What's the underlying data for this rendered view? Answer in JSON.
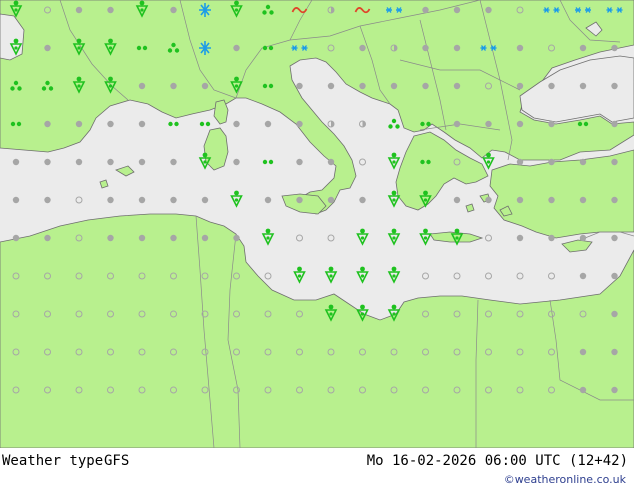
{
  "footer": {
    "product": "Weather type",
    "model": "GFS",
    "valid_time": "Mo 16-02-2026 06:00 UTC (12+42)",
    "credit": "©weatheronline.co.uk"
  },
  "colors": {
    "land": "#b8f08e",
    "sea": "#ebebeb",
    "border": "#8a8a8a",
    "coast": "#6e6e6e",
    "dry_dot": "#a6a6a6",
    "rain": "#1fc21f",
    "snow": "#1c9ce8",
    "thunder": "#e0442a"
  },
  "legend_icons": [
    "dry-dot-icon",
    "dry-ring-icon",
    "half-dot-icon",
    "light-rain-icon",
    "rain-icon",
    "rain-shower-icon",
    "snow-icon",
    "snow-shower-icon",
    "thunderstorm-icon"
  ],
  "map": {
    "region": "Mediterranean",
    "grid": {
      "cols": 21,
      "rows": 11,
      "cells": [
        "dsddhddrsrhtddddndddn",
        "rddrdhsddrndhddndndd",
        "hhrhdddrdddddddrdddd",
        "ddddddddddhhdddddddd",
        "ddddddrddddrrrrddddd",
        "ddcddddrddddrrdddddd",
        "ddcdddddrrccrrrrdddd",
        "cccccccccrrrrcccccdd",
        "ccccccccccrrcccccccd",
        "ccccccccccccccccccdd",
        "ccccccccccccccccccdd"
      ],
      "overrides": {
        "0.0": "rain-shower",
        "0.4": "rain-shower",
        "0.6": "snow-shower",
        "0.7": "rain-shower",
        "0.8": "light-rain-cluster",
        "0.9": "thunderstorm",
        "0.12": "snow",
        "0.17": "snow",
        "0.18": "snow",
        "0.19": "snow",
        "1.0": "rain-shower",
        "1.2": "rain-shower",
        "1.3": "rain-shower",
        "1.4": "drizzle",
        "1.5": "light-rain-cluster",
        "1.6": "snow-shower",
        "1.8": "drizzle",
        "1.9": "snow",
        "1.15": "snow",
        "2.0": "light-rain-cluster",
        "2.1": "light-rain-cluster",
        "2.2": "rain-shower",
        "2.3": "rain-shower",
        "2.7": "rain-shower",
        "2.8": "drizzle",
        "3.0": "drizzle",
        "3.5": "drizzle",
        "3.6": "drizzle",
        "3.12": "light-rain-cluster",
        "3.13": "drizzle",
        "3.18": "drizzle",
        "4.6": "rain-shower",
        "4.8": "drizzle",
        "4.12": "rain-shower",
        "4.13": "drizzle",
        "4.15": "rain-shower",
        "5.7": "rain-shower",
        "5.12": "rain-shower",
        "5.13": "rain-shower",
        "6.8": "rain-shower",
        "6.11": "rain-shower",
        "6.12": "rain-shower",
        "6.13": "rain-shower",
        "6.14": "rain-shower",
        "7.9": "rain-shower",
        "7.10": "rain-shower",
        "7.11": "rain-shower",
        "7.12": "rain-shower",
        "8.10": "rain-shower",
        "8.11": "rain-shower",
        "8.12": "rain-shower"
      }
    }
  }
}
